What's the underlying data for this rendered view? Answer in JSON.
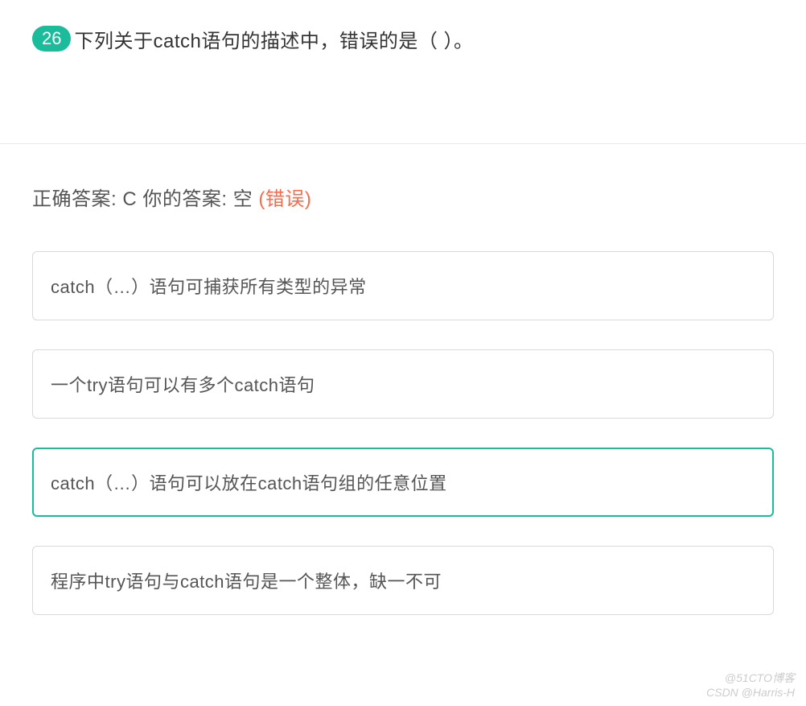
{
  "question": {
    "number": "26",
    "text": "下列关于catch语句的描述中，错误的是（ ）。"
  },
  "answer": {
    "correct_label": "正确答案: ",
    "correct_value": "C",
    "separator": "   ",
    "user_label": "你的答案: ",
    "user_value": "空 ",
    "status": "(错误)"
  },
  "options": [
    {
      "text": "catch（…）语句可捕获所有类型的异常",
      "correct": false
    },
    {
      "text": "一个try语句可以有多个catch语句",
      "correct": false
    },
    {
      "text": "catch（…）语句可以放在catch语句组的任意位置",
      "correct": true
    },
    {
      "text": "程序中try语句与catch语句是一个整体，缺一不可",
      "correct": false
    }
  ],
  "watermark": {
    "line1": "@51CTO博客",
    "line2": "CSDN @Harris-H"
  }
}
